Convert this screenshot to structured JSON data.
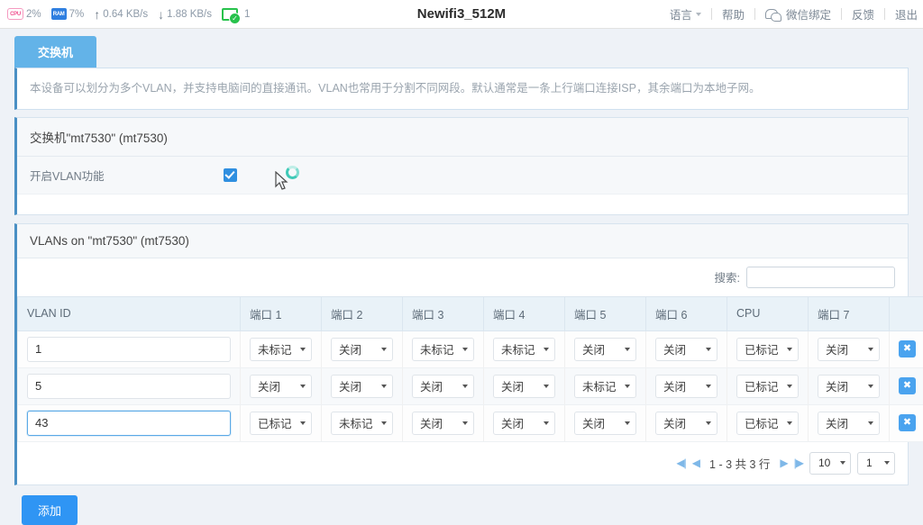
{
  "topbar": {
    "stats": [
      {
        "icon": "cpu-icon",
        "label": "CPU",
        "value": "2%"
      },
      {
        "icon": "ram-icon",
        "label": "RAM",
        "value": "7%"
      },
      {
        "icon": "upload-arrow-icon",
        "label": "↑",
        "value": "0.64 KB/s"
      },
      {
        "icon": "download-arrow-icon",
        "label": "↓",
        "value": "1.88 KB/s"
      },
      {
        "icon": "connected-device-icon",
        "label": "",
        "value": "1"
      }
    ],
    "title": "Newifi3_512M",
    "right_items": [
      {
        "label": "语言",
        "has_caret": true,
        "icon": ""
      },
      {
        "label": "帮助",
        "has_caret": false,
        "icon": ""
      },
      {
        "label": "微信绑定",
        "has_caret": false,
        "icon": "wechat-icon"
      },
      {
        "label": "反馈",
        "has_caret": false,
        "icon": ""
      },
      {
        "label": "退出",
        "has_caret": false,
        "icon": ""
      }
    ]
  },
  "tab": {
    "label": "交换机"
  },
  "description": "本设备可以划分为多个VLAN，并支持电脑间的直接通讯。VLAN也常用于分割不同网段。默认通常是一条上行端口连接ISP，其余端口为本地子网。",
  "switch_card": {
    "title": "交换机\"mt7530\" (mt7530)",
    "vlan_toggle_label": "开启VLAN功能",
    "vlan_toggle_checked": true
  },
  "vlan_card": {
    "title": "VLANs on \"mt7530\" (mt7530)",
    "search_label": "搜索:",
    "search_value": "",
    "search_placeholder": "",
    "columns": [
      "VLAN ID",
      "端口 1",
      "端口 2",
      "端口 3",
      "端口 4",
      "端口 5",
      "端口 6",
      "CPU",
      "端口 7",
      ""
    ],
    "rows": [
      {
        "vlan_id": "1",
        "focused": false,
        "ports": [
          "未标记",
          "关闭",
          "未标记",
          "未标记",
          "关闭",
          "关闭",
          "已标记",
          "关闭"
        ],
        "delete_label": "✖"
      },
      {
        "vlan_id": "5",
        "focused": false,
        "ports": [
          "关闭",
          "关闭",
          "关闭",
          "关闭",
          "未标记",
          "关闭",
          "已标记",
          "关闭"
        ],
        "delete_label": "✖"
      },
      {
        "vlan_id": "43",
        "focused": true,
        "ports": [
          "已标记",
          "未标记",
          "关闭",
          "关闭",
          "关闭",
          "关闭",
          "已标记",
          "关闭"
        ],
        "delete_label": "✖"
      }
    ],
    "pagination": {
      "first": "◀|",
      "prev": "◀",
      "info": "1 - 3 共 3 行",
      "next": "▶",
      "last": "|▶",
      "page_size": "10",
      "page_number": "1"
    }
  },
  "add_button_label": "添加",
  "colors": {
    "accent": "#2f95f4",
    "tab": "#63b3e8",
    "header_bg": "#e9f2f8",
    "checkbox": "#2f8fe0",
    "delete": "#4aa3ef"
  }
}
